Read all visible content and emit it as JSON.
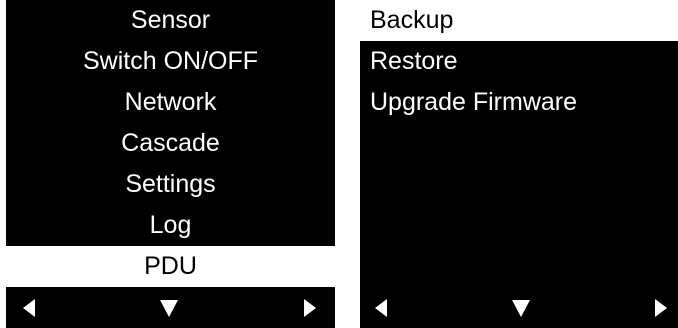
{
  "left_panel": {
    "items": [
      {
        "label": "Sensor"
      },
      {
        "label": "Switch ON/OFF"
      },
      {
        "label": "Network"
      },
      {
        "label": "Cascade"
      },
      {
        "label": "Settings"
      },
      {
        "label": "Log"
      },
      {
        "label": "PDU",
        "selected": true
      }
    ],
    "softkeys": [
      "left-arrow-icon",
      "down-arrow-icon",
      "right-arrow-icon"
    ]
  },
  "right_panel": {
    "items": [
      {
        "label": "Backup",
        "selected": true
      },
      {
        "label": "Restore"
      },
      {
        "label": "Upgrade Firmware"
      }
    ],
    "softkeys": [
      "left-arrow-icon",
      "down-arrow-icon",
      "right-arrow-icon"
    ]
  },
  "colors": {
    "screen_background": "#000000",
    "text": "#ffffff",
    "highlight_background": "#ffffff",
    "highlight_text": "#000000"
  }
}
